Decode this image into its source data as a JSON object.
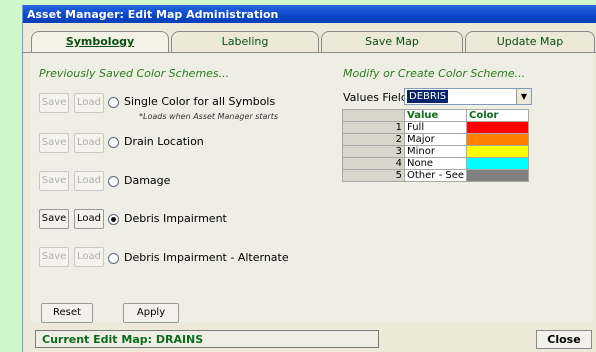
{
  "window": {
    "title": "Asset Manager: Edit Map Administration"
  },
  "tabs": [
    {
      "label": "Symbology",
      "active": true
    },
    {
      "label": "Labeling",
      "active": false
    },
    {
      "label": "Save Map",
      "active": false
    },
    {
      "label": "Update Map",
      "active": false
    }
  ],
  "left": {
    "heading": "Previously Saved Color Schemes...",
    "save_label": "Save",
    "load_label": "Load",
    "schemes": [
      {
        "label": "Single Color for all Symbols",
        "selected": false,
        "enabled": false,
        "note": "*Loads when Asset Manager starts"
      },
      {
        "label": "Drain Location",
        "selected": false,
        "enabled": false
      },
      {
        "label": "Damage",
        "selected": false,
        "enabled": false
      },
      {
        "label": "Debris Impairment",
        "selected": true,
        "enabled": true
      },
      {
        "label": "Debris Impairment - Alternate",
        "selected": false,
        "enabled": false
      }
    ],
    "reset_label": "Reset",
    "apply_label": "Apply"
  },
  "right": {
    "heading": "Modify or Create Color Scheme...",
    "values_field_label": "Values Field:",
    "values_field_value": "DEBRIS",
    "grid": {
      "headers": [
        "Value",
        "Color"
      ],
      "rows": [
        {
          "num": "1",
          "value": "Full",
          "color": "#ff0000"
        },
        {
          "num": "2",
          "value": "Major",
          "color": "#ff8000"
        },
        {
          "num": "3",
          "value": "Minor",
          "color": "#ffff00"
        },
        {
          "num": "4",
          "value": "None",
          "color": "#00ffff"
        },
        {
          "num": "5",
          "value": "Other - See",
          "color": "#808080"
        }
      ]
    }
  },
  "footer": {
    "status": "Current Edit Map: DRAINS",
    "close_label": "Close"
  },
  "colors": {
    "titlebar": "#0a46c8",
    "heading_green": "#2a7d1c",
    "background_green": "#cef7cc"
  }
}
